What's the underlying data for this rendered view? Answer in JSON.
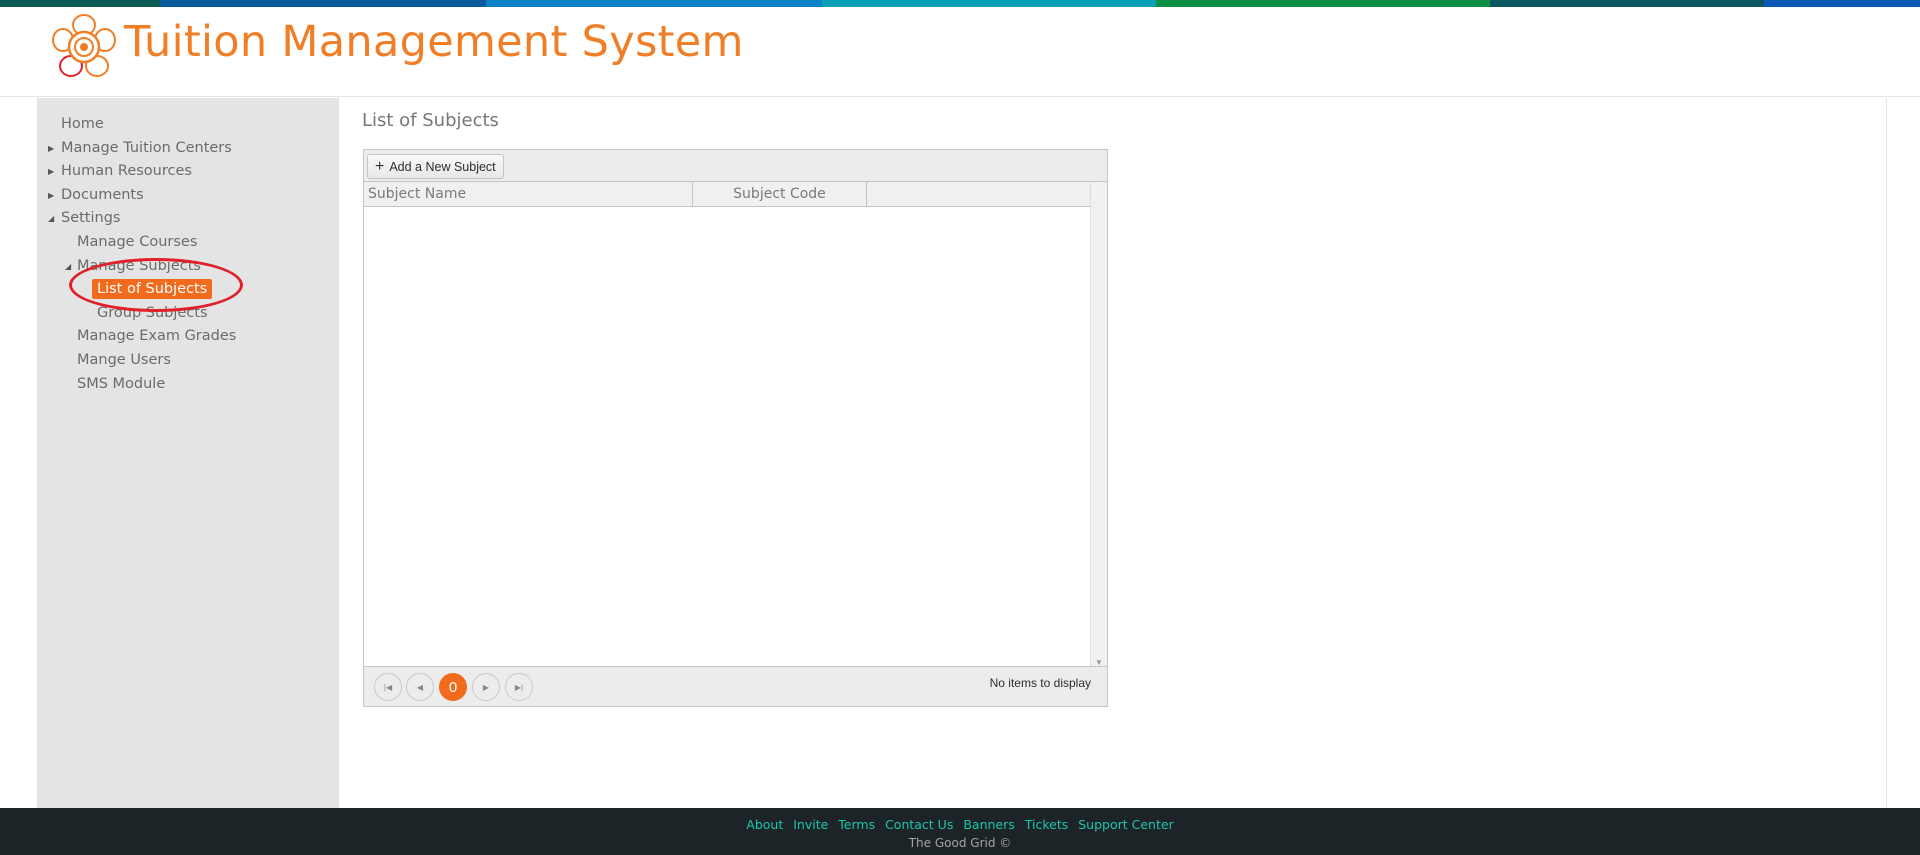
{
  "colors": {
    "accent": "#f26b1d",
    "title": "#f07e26",
    "footer_bg": "#1c2427",
    "footer_link": "#1ec4ab",
    "annotation": "#e0202a"
  },
  "header": {
    "title": "Tuition Management System",
    "logo_icon": "flower-logo-icon"
  },
  "sidebar": {
    "home": "Home",
    "manage_tuition_centers": "Manage Tuition Centers",
    "human_resources": "Human Resources",
    "documents": "Documents",
    "settings": "Settings",
    "manage_courses": "Manage Courses",
    "manage_subjects": "Manage Subjects",
    "list_of_subjects": "List of Subjects",
    "group_subjects": "Group Subjects",
    "manage_exam_grades": "Manage Exam Grades",
    "manage_users": "Mange Users",
    "sms_module": "SMS Module"
  },
  "main": {
    "page_title": "List of Subjects",
    "grid": {
      "add_button": "Add a New Subject",
      "columns": [
        "Subject Name",
        "Subject Code",
        ""
      ],
      "rows": [],
      "current_page": "0",
      "pager_info": "No items to display"
    }
  },
  "footer": {
    "links": [
      "About",
      "Invite",
      "Terms",
      "Contact Us",
      "Banners",
      "Tickets",
      "Support Center"
    ],
    "copyright": "The Good Grid ©"
  }
}
